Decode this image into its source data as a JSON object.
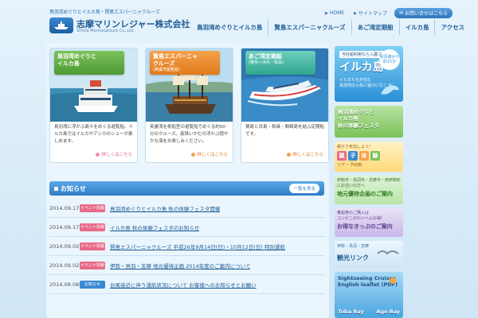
{
  "header": {
    "tagline": "鳥羽湾めぐりとイルカ島・賢島エスパーニャクルーズ",
    "company_name": "志摩マリンレジャー株式会社",
    "company_name_en": "Shima MarineLeisure Co.,Ltd.",
    "logo_text": "志摩観光汽船"
  },
  "top_links": {
    "home": "HOME",
    "sitemap": "サイトマップ",
    "contact": "お問い合せはこちら"
  },
  "nav": [
    "鳥羽湾めぐりとイルカ島",
    "賢島エスパーニャクルーズ",
    "あご湾定期船",
    "イルカ島",
    "アクセス"
  ],
  "cards": [
    {
      "title": "鳥羽湾めぐりと",
      "title2": "イルカ島",
      "subtitle": "",
      "text": "鳥羽湾に浮かぶ島々をめぐる遊覧船。イルカ島ではイルカやアシカのショーが楽しめます。",
      "more": "詳しくはこちら",
      "badge_color": "#5aa83e"
    },
    {
      "title": "賢島エスパーニャ",
      "title2": "クルーズ",
      "subtitle": "(英虞湾遊覧船)",
      "text": "英虞湾を帆船型の遊覧船でめぐる約50分のクルーズ。真珠いかだの浮かぶ穏やかな海をお楽しみください。",
      "more": "詳しくはこちら",
      "badge_color": "#e8892a"
    },
    {
      "title": "あご湾定期船",
      "title2": "",
      "subtitle": "(賢島〜浜島・和具)",
      "text": "賢島と浜島・和具・間崎島を結ぶ定期船です。",
      "more": "詳しくはこちら",
      "badge_color": "#2ea68f"
    }
  ],
  "news": {
    "title": "お知らせ",
    "all_label": "一覧を見る",
    "items": [
      {
        "date": "2014.09.17",
        "tag": "イベント情報",
        "tag_type": "event",
        "text": "鳥羽湾めぐりとイルカ島 秋の体験フェスタ開催"
      },
      {
        "date": "2014.09.17",
        "tag": "イベント情報",
        "tag_type": "event",
        "text": "イルカ島 秋の体験フェスタのお知らせ"
      },
      {
        "date": "2014.09.02",
        "tag": "イベント情報",
        "tag_type": "event",
        "text": "賢島エスパーニャクルーズ 平成26年9月14日(日)・10月12日(日) 特別運航"
      },
      {
        "date": "2014.09.02",
        "tag": "イベント情報",
        "tag_type": "event",
        "text": "伊勢・鳥羽・志摩 地元優待企画 2014年度のご案内について"
      },
      {
        "date": "2014.08.08",
        "tag": "お知らせ",
        "tag_type": "notice",
        "text": "台風接近に伴う運航状況について お客様へのお知らせとお願い"
      }
    ]
  },
  "side": {
    "iruka": {
      "t1": "当社船利用なら入園フリー!",
      "t2": "イルカ島",
      "t3a": "イルカたちが住む",
      "t3b": "鳥羽湾の小島に遊びに行こう!",
      "circle": "鳥羽港から約15分"
    },
    "fes": {
      "l1": "鳥羽湾めぐりと",
      "l2": "イルカ島",
      "l3": "秋の体験フェスタ"
    },
    "kids": {
      "s": "親子で参加しよう!",
      "b1": "親",
      "b2": "子",
      "b3": "体",
      "b4": "験",
      "tour": "ツアー 予約制"
    },
    "local": {
      "s1": "伊勢市・鳥羽市・志摩市・南伊勢町",
      "s2": "にお住いの方へ",
      "b": "地元優待企画のご案内"
    },
    "ticket": {
      "s1": "乗船券のご購入は",
      "s2": "コンビニがたいへんお得!",
      "b": "お得なきっぷのご案内"
    },
    "link": {
      "s": "伊勢・鳥羽・志摩",
      "b": "観光リンク"
    },
    "leaflet": {
      "l1": "Sightseeing Cruises",
      "l2": "English leaflet (PDF)",
      "bay1": "Toba Bay",
      "bay2": "Ago Bay"
    }
  },
  "colors": {
    "brand_blue": "#1f5d96",
    "accent_blue": "#3a88d1",
    "event_tag": "#e86a8a",
    "notice_tag": "#3a88d1"
  }
}
